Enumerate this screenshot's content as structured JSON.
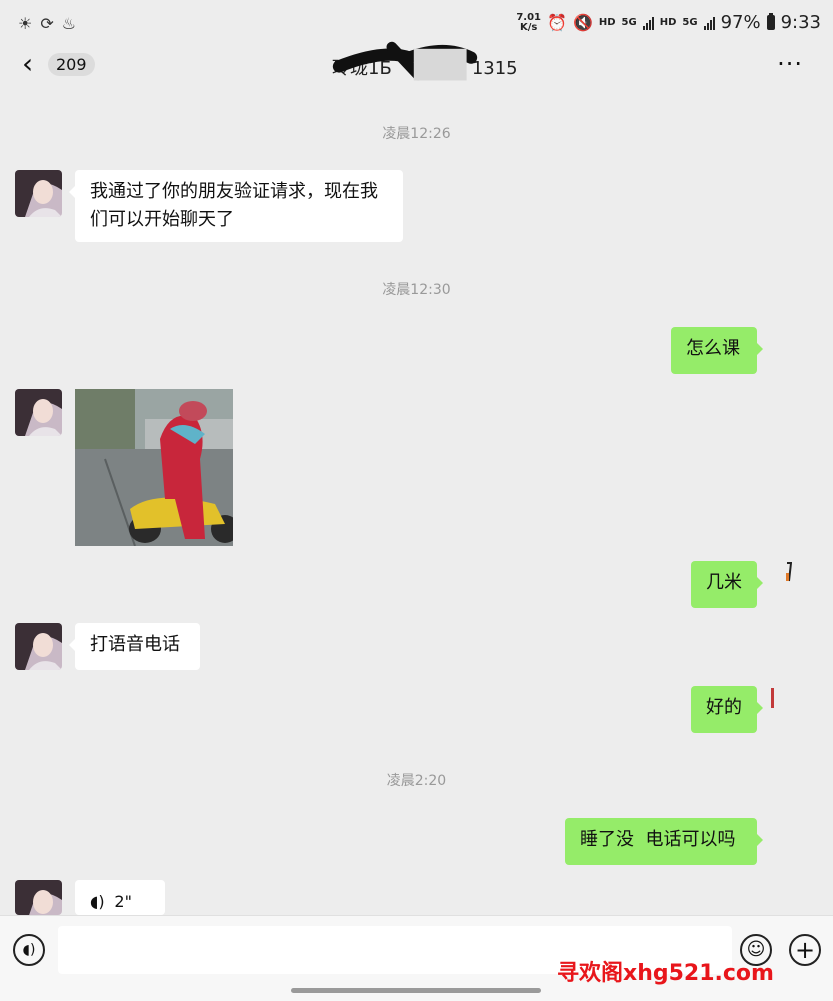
{
  "status_bar": {
    "netspeed_value": "7.01",
    "netspeed_unit": "K/s",
    "hd1": "HD",
    "g1": "5G",
    "hd2": "HD",
    "g2": "5G",
    "battery": "97%",
    "time": "9:33"
  },
  "nav": {
    "back_glyph": "‹",
    "unread_count": "209",
    "title_visible": "玲珑1Б",
    "title_visible_tail": "1315",
    "more_glyph": "···"
  },
  "messages": [
    {
      "type": "time",
      "text": "凌晨12:26"
    },
    {
      "type": "text",
      "side": "in",
      "text_line1": "我通过了你的朋友验证请求，现在我",
      "text_line2": "们可以开始聊天了"
    },
    {
      "type": "time",
      "text": "凌晨12:30"
    },
    {
      "type": "text",
      "side": "out",
      "text": "怎么课"
    },
    {
      "type": "image",
      "side": "in"
    },
    {
      "type": "text",
      "side": "out",
      "text": "几米"
    },
    {
      "type": "text",
      "side": "in",
      "text": "打语音电话"
    },
    {
      "type": "text",
      "side": "out",
      "text": "好的"
    },
    {
      "type": "time",
      "text": "凌晨2:20"
    },
    {
      "type": "text",
      "side": "out",
      "text": "睡了没  电话可以吗"
    },
    {
      "type": "voice",
      "side": "in",
      "duration": "2\""
    }
  ],
  "input": {
    "placeholder": ""
  },
  "watermark": "寻欢阁xhg521.com",
  "colors": {
    "background": "#ededed",
    "outgoing_bubble": "#95ec69",
    "incoming_bubble": "#ffffff",
    "watermark": "#e8161b"
  },
  "icons": {
    "status_left": [
      "brightness-icon",
      "sync-icon",
      "notification-icon"
    ],
    "status_right": [
      "alarm-icon",
      "mute-icon",
      "signal-icon",
      "battery-icon"
    ]
  }
}
